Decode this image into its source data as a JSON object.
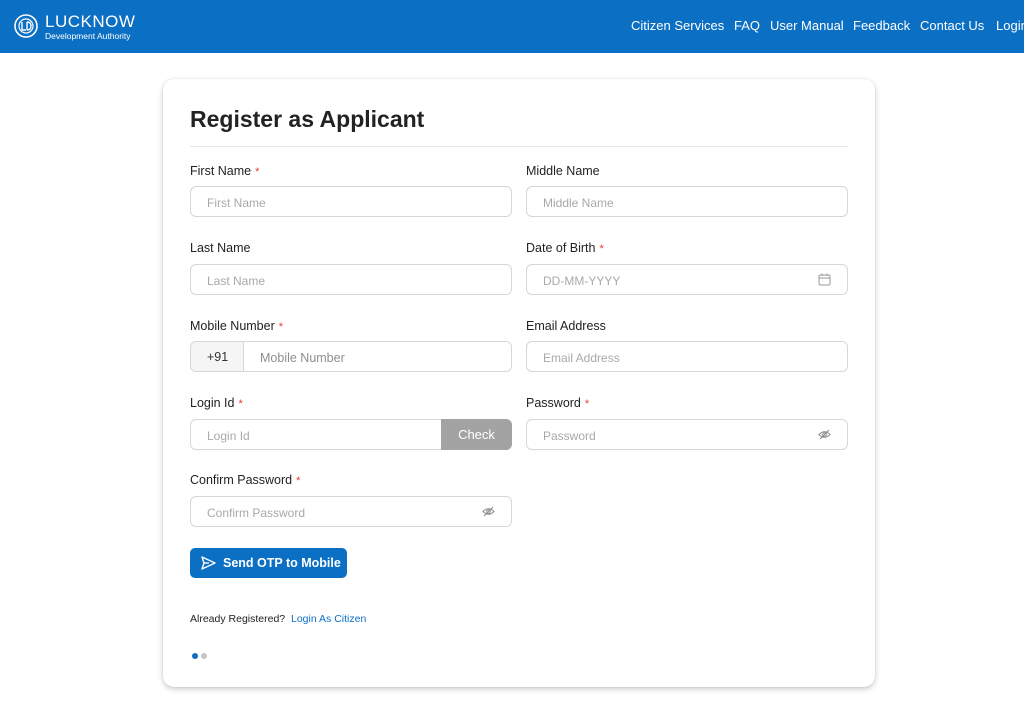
{
  "brand": {
    "name": "LUCKNOW",
    "subtitle": "Development Authority"
  },
  "nav": {
    "items": [
      "Citizen Services",
      "FAQ",
      "User Manual",
      "Feedback",
      "Contact Us",
      "Login"
    ]
  },
  "form": {
    "title": "Register as Applicant",
    "required_marker": "*",
    "first_name": {
      "label": "First Name",
      "placeholder": "First Name"
    },
    "middle_name": {
      "label": "Middle Name",
      "placeholder": "Middle Name"
    },
    "last_name": {
      "label": "Last Name",
      "placeholder": "Last Name"
    },
    "dob": {
      "label": "Date of Birth",
      "placeholder": "DD-MM-YYYY",
      "icon": "calendar-icon"
    },
    "mobile": {
      "label": "Mobile Number",
      "prefix": "+91",
      "placeholder": "Mobile Number"
    },
    "email": {
      "label": "Email Address",
      "placeholder": "Email Address"
    },
    "login_id": {
      "label": "Login Id",
      "placeholder": "Login Id",
      "check_label": "Check"
    },
    "password": {
      "label": "Password",
      "placeholder": "Password",
      "icon": "eye-off-icon"
    },
    "confirm_password": {
      "label": "Confirm Password",
      "placeholder": "Confirm Password",
      "icon": "eye-off-icon"
    },
    "send_otp_label": "Send OTP to Mobile",
    "already_registered": "Already Registered?",
    "login_link": "Login As Citizen"
  },
  "pagination": {
    "total": 2,
    "active": 1
  },
  "colors": {
    "primary": "#0b6fc4",
    "required": "#e53935",
    "check_button": "#a3a3a3",
    "dot_inactive": "#c4c4c4"
  }
}
